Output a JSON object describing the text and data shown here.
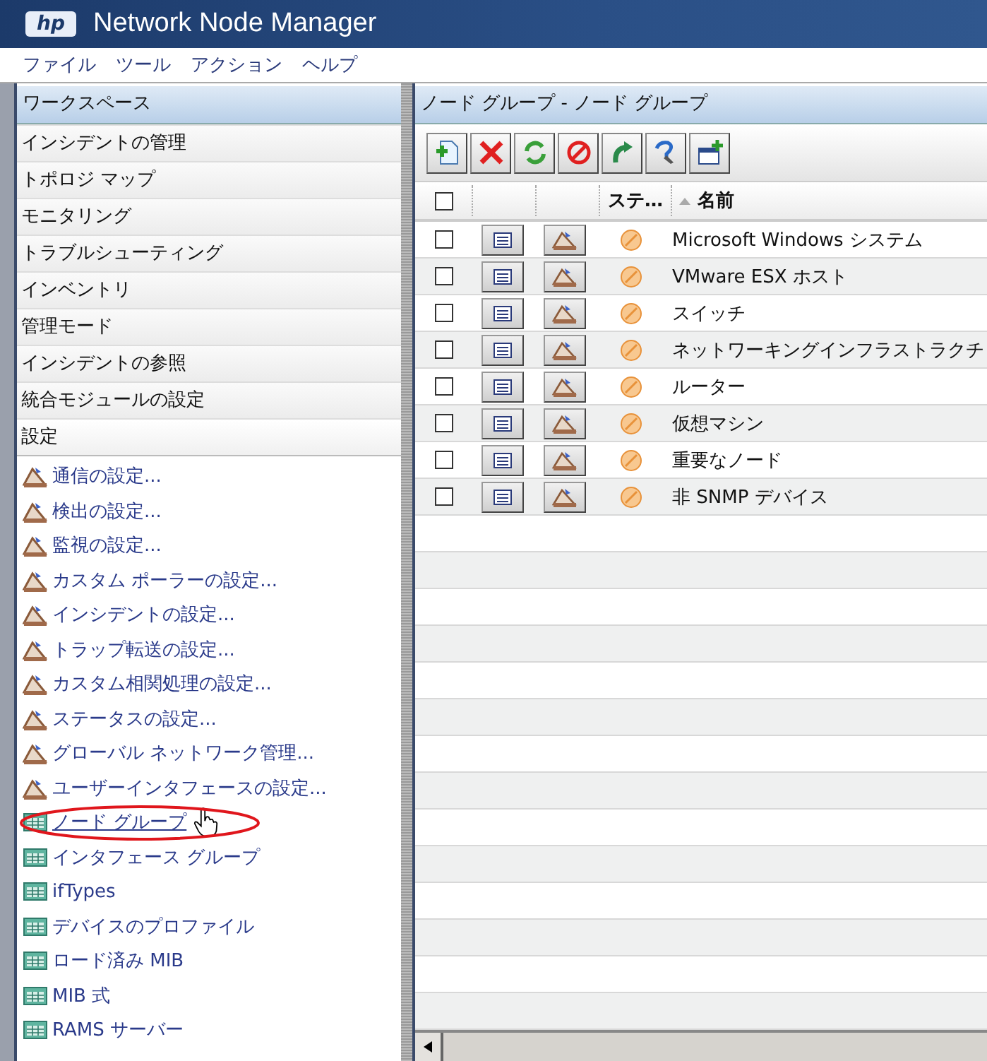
{
  "window": {
    "title": "Network Node Manager",
    "logo_text": "hp"
  },
  "menu": [
    "ファイル",
    "ツール",
    "アクション",
    "ヘルプ"
  ],
  "workspace": {
    "title": "ワークスペース",
    "sections": [
      {
        "label": "インシデントの管理",
        "expanded": false
      },
      {
        "label": "トポロジ マップ",
        "expanded": false
      },
      {
        "label": "モニタリング",
        "expanded": false
      },
      {
        "label": "トラブルシューティング",
        "expanded": false
      },
      {
        "label": "インベントリ",
        "expanded": false
      },
      {
        "label": "管理モード",
        "expanded": false
      },
      {
        "label": "インシデントの参照",
        "expanded": false
      },
      {
        "label": "統合モジュールの設定",
        "expanded": false
      },
      {
        "label": "設定",
        "expanded": true
      }
    ],
    "items": [
      {
        "label": "通信の設定...",
        "kind": "form",
        "hovered": false
      },
      {
        "label": "検出の設定...",
        "kind": "form",
        "hovered": false
      },
      {
        "label": "監視の設定...",
        "kind": "form",
        "hovered": false
      },
      {
        "label": "カスタム ポーラーの設定...",
        "kind": "form",
        "hovered": false
      },
      {
        "label": "インシデントの設定...",
        "kind": "form",
        "hovered": false
      },
      {
        "label": "トラップ転送の設定...",
        "kind": "form",
        "hovered": false
      },
      {
        "label": "カスタム相関処理の設定...",
        "kind": "form",
        "hovered": false
      },
      {
        "label": "ステータスの設定...",
        "kind": "form",
        "hovered": false
      },
      {
        "label": "グローバル ネットワーク管理...",
        "kind": "form",
        "hovered": false
      },
      {
        "label": "ユーザーインタフェースの設定...",
        "kind": "form",
        "hovered": false
      },
      {
        "label": "ノード グループ",
        "kind": "table",
        "hovered": true
      },
      {
        "label": "インタフェース グループ",
        "kind": "table",
        "hovered": false
      },
      {
        "label": "ifTypes",
        "kind": "table",
        "hovered": false
      },
      {
        "label": "デバイスのプロファイル",
        "kind": "table",
        "hovered": false
      },
      {
        "label": "ロード済み MIB",
        "kind": "table",
        "hovered": false
      },
      {
        "label": "MIB 式",
        "kind": "table",
        "hovered": false
      },
      {
        "label": "RAMS サーバー",
        "kind": "table",
        "hovered": false
      }
    ]
  },
  "view": {
    "title": "ノード グループ - ノード グループ",
    "columns": [
      "ステ…",
      "名前"
    ],
    "header_checked": false,
    "rows": [
      {
        "checked": false,
        "name": "Microsoft Windows システム"
      },
      {
        "checked": false,
        "name": "VMware ESX ホスト"
      },
      {
        "checked": false,
        "name": "スイッチ"
      },
      {
        "checked": false,
        "name": "ネットワーキングインフラストラクチ"
      },
      {
        "checked": false,
        "name": "ルーター"
      },
      {
        "checked": false,
        "name": "仮想マシン"
      },
      {
        "checked": false,
        "name": "重要なノード"
      },
      {
        "checked": false,
        "name": "非 SNMP デバイス"
      }
    ]
  }
}
